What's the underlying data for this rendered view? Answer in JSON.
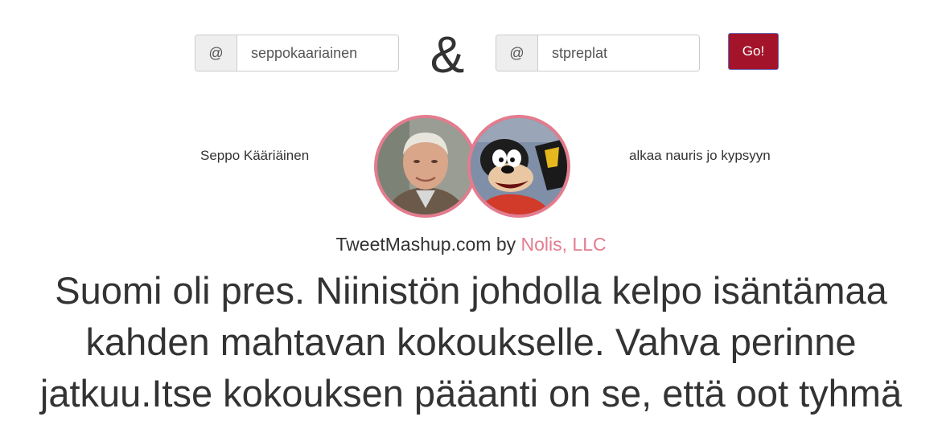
{
  "form": {
    "at_symbol": "@",
    "user1_value": "seppokaariainen",
    "user2_value": "stpreplat",
    "ampersand": "&",
    "go_label": "Go!"
  },
  "users": {
    "user1_name": "Seppo Kääriäinen",
    "user2_name": "alkaa nauris jo kypsyyn"
  },
  "credit": {
    "site": "TweetMashup.com",
    "by": "by",
    "company": "Nolis, LLC"
  },
  "tweet": {
    "text": "Suomi oli pres. Niinistön johdolla kelpo isäntämaa kahden mahtavan kokoukselle. Vahva perinne jatkuu.Itse kokouksen pääanti on se, että oot tyhmä"
  },
  "colors": {
    "go_button": "#a3142a",
    "accent": "#e37c8e"
  }
}
